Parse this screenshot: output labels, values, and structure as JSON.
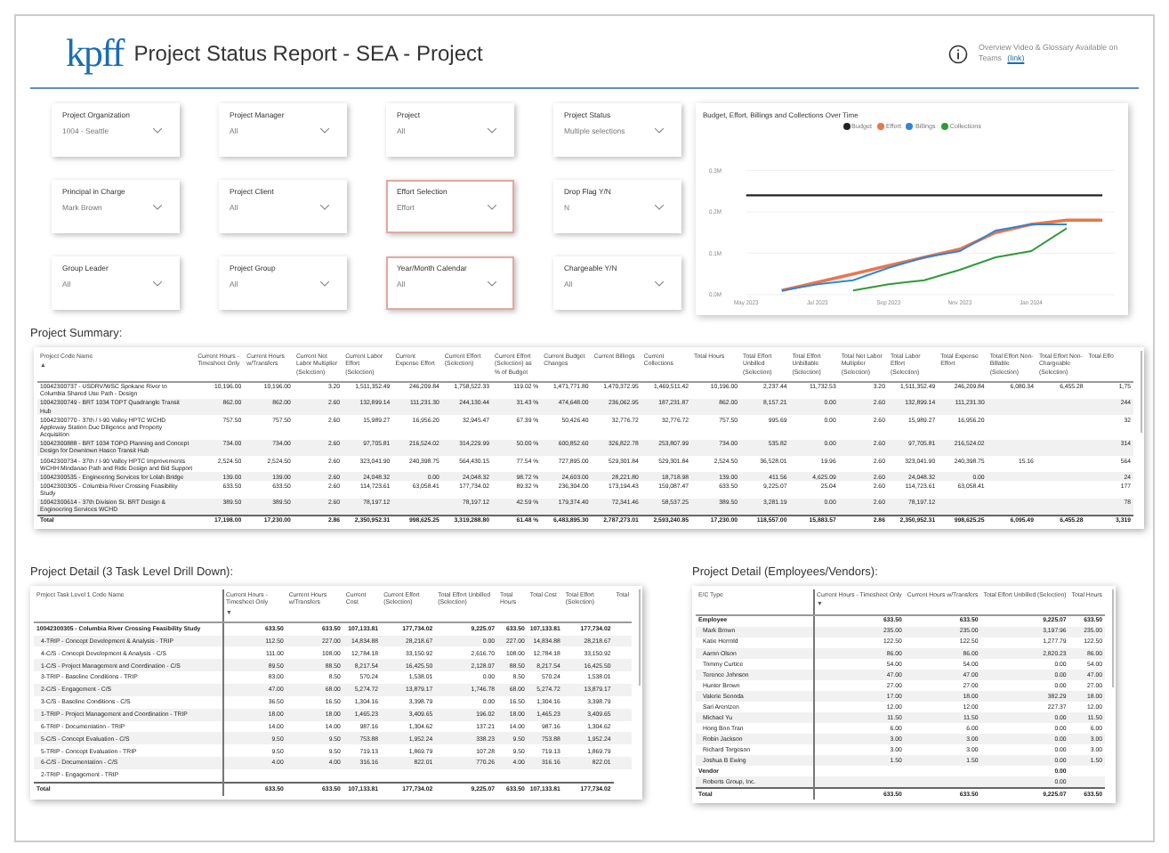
{
  "header": {
    "logo": "kpff",
    "title": "Project Status Report - SEA - Project",
    "info_text": "Overview Video & Glossary Available on Teams",
    "info_link": "(link)"
  },
  "filters": [
    {
      "label": "Project Organization",
      "value": "1004 - Seattle",
      "highlighted": false
    },
    {
      "label": "Project Manager",
      "value": "All",
      "highlighted": false
    },
    {
      "label": "Project",
      "value": "All",
      "highlighted": false
    },
    {
      "label": "Project Status",
      "value": "Multiple selections",
      "highlighted": false
    },
    {
      "label": "Principal in Charge",
      "value": "Mark Brown",
      "highlighted": false
    },
    {
      "label": "Project Client",
      "value": "All",
      "highlighted": false
    },
    {
      "label": "Effort Selection",
      "value": "Effort",
      "highlighted": true
    },
    {
      "label": "Drop Flag Y/N",
      "value": "N",
      "highlighted": false
    },
    {
      "label": "Group Leader",
      "value": "All",
      "highlighted": false
    },
    {
      "label": "Project Group",
      "value": "All",
      "highlighted": false
    },
    {
      "label": "Year/Month Calendar",
      "value": "All",
      "highlighted": true
    },
    {
      "label": "Chargeable Y/N",
      "value": "All",
      "highlighted": false
    }
  ],
  "chart": {
    "chart_data": {
      "type": "line",
      "title": "Budget, Effort, Billings and Collections Over Time",
      "categories": [
        "May 2023",
        null,
        "Jul 2023",
        null,
        "Sep 2023",
        null,
        "Nov 2023",
        null,
        "Jan 2024",
        null,
        null
      ],
      "yticks": [
        {
          "value": 0,
          "label": "0.0M"
        },
        {
          "value": 0.1,
          "label": "0.1M"
        },
        {
          "value": 0.2,
          "label": "0.2M"
        },
        {
          "value": 0.3,
          "label": "0.3M"
        }
      ],
      "ylim": [
        0,
        0.3
      ],
      "series": [
        {
          "name": "Budget",
          "color": "#222222",
          "values": [
            0.24,
            0.24,
            0.24,
            0.24,
            0.24,
            0.24,
            0.24,
            0.24,
            0.24,
            0.24,
            0.24
          ]
        },
        {
          "name": "Effort",
          "color": "#e8774a",
          "values": [
            null,
            0.01,
            0.03,
            0.05,
            0.07,
            0.09,
            0.11,
            0.15,
            0.17,
            0.18,
            0.18
          ]
        },
        {
          "name": "Billings",
          "color": "#2f86d8",
          "values": [
            null,
            0.01,
            0.025,
            0.035,
            0.065,
            0.09,
            0.105,
            0.155,
            0.17,
            0.17,
            null
          ]
        },
        {
          "name": "Collections",
          "color": "#2e9a3a",
          "values": [
            null,
            null,
            null,
            0.01,
            0.025,
            0.035,
            0.06,
            0.09,
            0.105,
            0.16,
            null
          ]
        }
      ]
    }
  },
  "project_summary": {
    "title": "Project Summary:",
    "sort_arrow": "▲",
    "columns": [
      "Project Code Name",
      "Current Hours - Timesheet Only",
      "Current Hours w/Transfers",
      "Current Net Labor Multiplier (Selection)",
      "Current Labor Effort (Selection)",
      "Current Expense Effort",
      "Current Effort (Selection)",
      "Current Effort (Selection) as % of Budget",
      "Current Budget Changes",
      "Current Billings",
      "Current Collections",
      "Total Hours",
      "Total Effort Unbilled (Selection)",
      "Total Effort Unbillable (Selection)",
      "Total Net Labor Multiplier (Selection)",
      "Total Labor Effort (Selection)",
      "Total Expense Effort",
      "Total Effort Non-Billable (Selection)",
      "Total Effort Non-Chargeable (Selection)",
      "Total Effo"
    ],
    "rows": [
      {
        "cells": [
          "10042300737 - USDRV/WSC Spokane River to Columbia Shared Use Path - Design",
          "10,196.00",
          "10,196.00",
          "3.20",
          "1,511,352.49",
          "246,209.84",
          "1,758,522.33",
          "119.02 %",
          "1,471,771.80",
          "1,470,372.95",
          "1,469,511.42",
          "10,196.00",
          "2,237.44",
          "11,732.53",
          "3.20",
          "1,511,352.49",
          "246,209.84",
          "6,080.34",
          "6,455.28",
          "1,75"
        ]
      },
      {
        "cells": [
          "10042300749 - BRT 1034 TOPT Quadrangle Transit Hub",
          "862.00",
          "862.00",
          "2.60",
          "132,899.14",
          "111,231.30",
          "244,130.44",
          "31.43 %",
          "474,648.00",
          "236,062.95",
          "187,231.87",
          "862.00",
          "8,157.21",
          "0.00",
          "2.60",
          "132,899.14",
          "111,231.30",
          "",
          "",
          "244"
        ]
      },
      {
        "cells": [
          "10042300770 - 37th / I-90 Valley HPTC WCHD Appleway Station Due Diligence and Property Acquisition",
          "757.50",
          "757.50",
          "2.60",
          "15,989.27",
          "16,956.20",
          "32,945.47",
          "67.39 %",
          "50,426.40",
          "32,776.72",
          "32,776.72",
          "757.50",
          "995.69",
          "0.00",
          "2.60",
          "15,989.27",
          "16,956.20",
          "",
          "",
          "32"
        ]
      },
      {
        "cells": [
          "10042300888 - BRT 1034 TOPO Planning and Concept Design for Downtown Hasco Transit Hub",
          "734.00",
          "734.00",
          "2.60",
          "97,705.81",
          "216,524.02",
          "314,229.99",
          "50.00 %",
          "600,852.60",
          "326,822.78",
          "253,807.99",
          "734.00",
          "535.82",
          "0.00",
          "2.60",
          "97,705.81",
          "216,524.02",
          "",
          "",
          "314"
        ]
      },
      {
        "cells": [
          "10042300734 - 37th / I-90 Valley HPTC Improvements WCHH Mindanao Path and Ride Design and Bid Support",
          "2,524.50",
          "2,524.50",
          "2.60",
          "323,041.90",
          "240,398.75",
          "564,430.15",
          "77.54 %",
          "727,895.00",
          "529,301.84",
          "529,301.84",
          "2,524.50",
          "36,528.01",
          "19.96",
          "2.60",
          "323,041.90",
          "240,398.75",
          "15.16",
          "",
          "564"
        ]
      },
      {
        "cells": [
          "10042300535 - Engineering Services for Lolah Bridge",
          "139.00",
          "139.00",
          "2.60",
          "24,048.32",
          "0.00",
          "24,048.32",
          "98.72 %",
          "24,603.00",
          "28,221.80",
          "18,718.98",
          "139.00",
          "411.56",
          "4,625.09",
          "2.60",
          "24,048.32",
          "0.00",
          "",
          "",
          "24"
        ]
      },
      {
        "cells": [
          "10042300305 - Columbia River Crossing Feasibility Study",
          "633.50",
          "633.50",
          "2.60",
          "114,723.61",
          "63,058.41",
          "177,734.02",
          "89.32 %",
          "236,304.00",
          "173,194.43",
          "159,087.47",
          "633.50",
          "9,225.07",
          "25.04",
          "2.60",
          "114,723.61",
          "63,058.41",
          "",
          "",
          "177"
        ]
      },
      {
        "cells": [
          "10042300614 - 37th Division St. BRT Design & Engineering Services WCHD",
          "389.50",
          "389.50",
          "2.60",
          "78,197.12",
          "",
          "78,197.12",
          "42.59 %",
          "179,374.40",
          "72,341.46",
          "58,537.25",
          "389.50",
          "3,281.19",
          "0.00",
          "2.60",
          "78,197.12",
          "",
          "",
          "",
          "78"
        ]
      }
    ],
    "total": [
      "Total",
      "17,198.00",
      "17,230.00",
      "2.86",
      "2,350,952.31",
      "998,625.25",
      "3,319,288.80",
      "61.48 %",
      "6,483,895.30",
      "2,787,273.01",
      "2,593,240.85",
      "17,230.00",
      "118,557.00",
      "15,883.57",
      "2.86",
      "2,350,952.31",
      "998,625.25",
      "6,095.49",
      "6,455.28",
      "3,319"
    ]
  },
  "task_detail": {
    "title": "Project Detail (3 Task Level Drill Down):",
    "sort_arrow": "▼",
    "columns": [
      "Project Task Level 1 Code Name",
      "Current Hours - Timesheet Only",
      "Current Hours w/Transfers",
      "Current Cost",
      "Current Effort (Selection)",
      "Total Effort Unbilled (Selection)",
      "Total Hours",
      "Total Cost",
      "Total Effort (Selection)",
      "Total"
    ],
    "rows": [
      {
        "kind": "group",
        "cells": [
          "10042300305 - Columbia River Crossing Feasibility Study",
          "633.50",
          "633.50",
          "107,133.81",
          "177,734.02",
          "9,225.07",
          "633.50",
          "107,133.81",
          "177,734.02",
          ""
        ]
      },
      {
        "kind": "task",
        "cells": [
          "4-TRIP - Concept Development & Analysis - TRIP",
          "112.50",
          "227.00",
          "14,834.88",
          "28,218.67",
          "0.00",
          "227.00",
          "14,834.88",
          "28,218.67",
          ""
        ]
      },
      {
        "kind": "task",
        "cells": [
          "4-C/S - Concept Development & Analysis - C/S",
          "111.00",
          "108.00",
          "12,784.18",
          "33,150.92",
          "2,616.70",
          "108.00",
          "12,784.18",
          "33,150.92",
          ""
        ]
      },
      {
        "kind": "task",
        "cells": [
          "1-C/S - Project Management and Coordination - C/S",
          "89.50",
          "88.50",
          "8,217.54",
          "16,425.50",
          "2,128.07",
          "88.50",
          "8,217.54",
          "16,425.50",
          ""
        ]
      },
      {
        "kind": "task",
        "cells": [
          "3-TRIP - Baseline Conditions - TRIP",
          "83.00",
          "8.50",
          "570.24",
          "1,538.01",
          "0.00",
          "8.50",
          "570.24",
          "1,538.01",
          ""
        ]
      },
      {
        "kind": "task",
        "cells": [
          "2-C/S - Engagement - C/S",
          "47.00",
          "68.00",
          "5,274.72",
          "13,879.17",
          "1,746.78",
          "68.00",
          "5,274.72",
          "13,879.17",
          ""
        ]
      },
      {
        "kind": "task",
        "cells": [
          "3-C/S - Baseline Conditions - C/S",
          "36.50",
          "16.50",
          "1,304.16",
          "3,398.79",
          "0.00",
          "16.50",
          "1,304.16",
          "3,398.79",
          ""
        ]
      },
      {
        "kind": "task",
        "cells": [
          "1-TRIP - Project Management and Coordination - TRIP",
          "18.00",
          "18.00",
          "1,465.23",
          "3,409.65",
          "196.02",
          "18.00",
          "1,465.23",
          "3,409.65",
          ""
        ]
      },
      {
        "kind": "task",
        "cells": [
          "6-TRIP - Documentation - TRIP",
          "14.00",
          "14.00",
          "987.16",
          "1,304.62",
          "137.21",
          "14.00",
          "987.16",
          "1,304.62",
          ""
        ]
      },
      {
        "kind": "task",
        "cells": [
          "5-C/S - Concept Evaluation - C/S",
          "9.50",
          "9.50",
          "753.88",
          "1,952.24",
          "338.23",
          "9.50",
          "753.88",
          "1,952.24",
          ""
        ]
      },
      {
        "kind": "task",
        "cells": [
          "5-TRIP - Concept Evaluation - TRIP",
          "9.50",
          "9.50",
          "719.13",
          "1,869.79",
          "107.28",
          "9.50",
          "719.13",
          "1,869.79",
          ""
        ]
      },
      {
        "kind": "task",
        "cells": [
          "6-C/S - Documentation - C/S",
          "4.00",
          "4.00",
          "316.16",
          "822.01",
          "770.26",
          "4.00",
          "316.16",
          "822.01",
          ""
        ]
      },
      {
        "kind": "task",
        "cells": [
          "2-TRIP - Engagement - TRIP",
          "",
          "",
          "",
          "",
          "",
          "",
          "",
          "",
          ""
        ]
      }
    ],
    "total": [
      "Total",
      "633.50",
      "633.50",
      "107,133.81",
      "177,734.02",
      "9,225.07",
      "633.50",
      "107,133.81",
      "177,734.02"
    ]
  },
  "employee_detail": {
    "title": "Project Detail (Employees/Vendors):",
    "sort_arrow": "▼",
    "columns": [
      "E/C Type",
      "Current Hours - Timesheet Only",
      "Current Hours w/Transfers",
      "Total Effort Unbilled (Selection)",
      "Total Hours"
    ],
    "rows": [
      {
        "kind": "group",
        "cells": [
          "Employee",
          "633.50",
          "633.50",
          "9,225.07",
          "633.50"
        ]
      },
      {
        "kind": "person",
        "cells": [
          "Mark Brown",
          "235.00",
          "235.00",
          "3,197.96",
          "235.00"
        ]
      },
      {
        "kind": "person",
        "cells": [
          "Katie Herrold",
          "122.50",
          "122.50",
          "1,277.79",
          "122.50"
        ]
      },
      {
        "kind": "person",
        "cells": [
          "Aaron Olson",
          "86.00",
          "86.00",
          "2,820.23",
          "86.00"
        ]
      },
      {
        "kind": "person",
        "cells": [
          "Tommy Curtice",
          "54.00",
          "54.00",
          "0.00",
          "54.00"
        ]
      },
      {
        "kind": "person",
        "cells": [
          "Terence Johnson",
          "47.00",
          "47.00",
          "0.00",
          "47.00"
        ]
      },
      {
        "kind": "person",
        "cells": [
          "Hunter Brown",
          "27.00",
          "27.00",
          "0.00",
          "27.00"
        ]
      },
      {
        "kind": "person",
        "cells": [
          "Valerie Senoda",
          "17.00",
          "18.00",
          "382.29",
          "18.00"
        ]
      },
      {
        "kind": "person",
        "cells": [
          "Sari Arentzen",
          "12.00",
          "12.00",
          "227.37",
          "12.00"
        ]
      },
      {
        "kind": "person",
        "cells": [
          "Michael Yu",
          "11.50",
          "11.50",
          "0.00",
          "11.50"
        ]
      },
      {
        "kind": "person",
        "cells": [
          "Hong Bon Tran",
          "6.00",
          "6.00",
          "0.00",
          "6.00"
        ]
      },
      {
        "kind": "person",
        "cells": [
          "Robin Jackson",
          "3.00",
          "3.00",
          "0.00",
          "3.00"
        ]
      },
      {
        "kind": "person",
        "cells": [
          "Richard Torgeson",
          "3.00",
          "3.00",
          "0.00",
          "3.00"
        ]
      },
      {
        "kind": "person",
        "cells": [
          "Joshua B Ewing",
          "1.50",
          "1.50",
          "0.00",
          "1.50"
        ]
      },
      {
        "kind": "group",
        "cells": [
          "Vendor",
          "",
          "",
          "0.00",
          ""
        ]
      },
      {
        "kind": "person",
        "cells": [
          "Roberts Group, Inc.",
          "",
          "",
          "0.00",
          ""
        ]
      }
    ],
    "total": [
      "Total",
      "633.50",
      "633.50",
      "9,225.07",
      "633.50"
    ]
  }
}
